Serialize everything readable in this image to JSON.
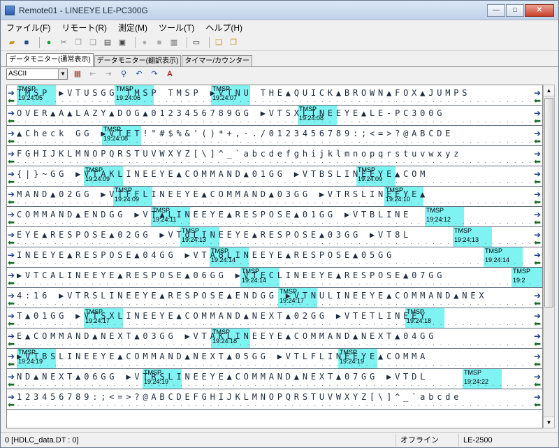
{
  "window": {
    "title": "Remote01 - LINEEYE LE-PC300G"
  },
  "window_controls": {
    "minimize": "—",
    "maximize": "□",
    "close": "✕"
  },
  "menu": [
    "ファイル(F)",
    "リモート(R)",
    "測定(M)",
    "ツール(T)",
    "ヘルプ(H)"
  ],
  "tabs": [
    "データモニター(通常表示)",
    "データモニター(翻訳表示)",
    "タイマー/カウンター"
  ],
  "code_select": {
    "value": "ASCII"
  },
  "rows": [
    {
      "text": "TMSP ▶VTUSGG TMSP TMSP ▶VTNU THE▲QUICK▲BROWN▲FOX▲JUMPS",
      "stamps": [
        {
          "label": "TMSP",
          "time": "19:24:05"
        },
        {
          "label": "TMSP",
          "time": "19:24:06"
        },
        {
          "label": "TMSP",
          "time": "19:24:07"
        }
      ]
    },
    {
      "text": "OVER▲A▲LAZY▲DOG▲0123456789GG ▶VTSXLINEEYE▲LE-PC300G",
      "stamps": [
        {
          "label": "TMSP",
          "time": "19:24:08"
        }
      ]
    },
    {
      "text": "▲Check GG ▶VTET!\"#$%&'()*+,-./0123456789:;<=>?@ABCDE",
      "stamps": [
        {
          "label": "TMSP",
          "time": "19:24:08"
        }
      ]
    },
    {
      "text": "FGHIJKLMNOPQRSTUVWXYZ[\\]^_`abcdefghijklmnopqrstuvwxyz",
      "stamps": []
    },
    {
      "text": "{|}~GG ▶VTAKLINEEYE▲COMMAND▲01GG ▶VTBSLINEEYE▲COM",
      "stamps": [
        {
          "label": "TMSP",
          "time": "19:24:09"
        },
        {
          "label": "TMSP",
          "time": "19:24:09"
        }
      ]
    },
    {
      "text": "MAND▲02GG ▶VTFFLINEEYE▲COMMAND▲03GG ▶VTRSLINEEYE▲",
      "stamps": [
        {
          "label": "TMSP",
          "time": "19:24:09"
        },
        {
          "label": "TMSP",
          "time": "19:24:10"
        }
      ]
    },
    {
      "text": "COMMAND▲ENDGG ▶VT▲LINEEYE▲RESPOSE▲01GG ▶VTBLINE",
      "stamps": [
        {
          "label": "TMSP",
          "time": "19:24:11"
        },
        {
          "label": "TMSP",
          "time": "19:24:12"
        }
      ]
    },
    {
      "text": "EYE▲RESPOSE▲02GG ▶VTdLINEEYE▲RESPOSE▲03GG ▶VT8L",
      "stamps": [
        {
          "label": "TMSP",
          "time": "19:24:13"
        },
        {
          "label": "TMSP",
          "time": "19:24:13"
        }
      ]
    },
    {
      "text": "INEEYE▲RESPOSE▲04GG ▶VTA8LINEEYE▲RESPOSE▲05GG",
      "stamps": [
        {
          "label": "TMSP",
          "time": "19:24:14"
        },
        {
          "label": "TMSP",
          "time": "19:24:14"
        }
      ]
    },
    {
      "text": "▶VTCALINEEYE▲RESPOSE▲06GG ▶VTECLINEEYE▲RESPOSE▲07GG",
      "stamps": [
        {
          "label": "TMSP",
          "time": "19:24:14"
        },
        {
          "label": "TMSP",
          "time": "19:2"
        }
      ]
    },
    {
      "text": "4:16 ▶VTRSLINEEYE▲RESPOSE▲ENDGG ▶VTNULINEEYE▲COMMAND▲NEX",
      "stamps": [
        {
          "label": "TMSP",
          "time": "19:24:17"
        }
      ]
    },
    {
      "text": "T▲01GG ▶VTSXLINEEYE▲COMMAND▲NEXT▲02GG ▶VTETLINEEY",
      "stamps": [
        {
          "label": "TMSP",
          "time": "19:24:17"
        },
        {
          "label": "TMSP",
          "time": "19:24:18"
        }
      ]
    },
    {
      "text": "E▲COMMAND▲NEXT▲03GG ▶VTAKLINEEYE▲COMMAND▲NEXT▲04GG",
      "stamps": [
        {
          "label": "TMSP",
          "time": "19:24:18"
        }
      ]
    },
    {
      "text": "▶VTBSLINEEYE▲COMMAND▲NEXT▲05GG ▶VTLFLINEEYE▲COMMA",
      "stamps": [
        {
          "label": "TMSP",
          "time": "19:24:19"
        },
        {
          "label": "TMSP",
          "time": "19:24:19"
        }
      ]
    },
    {
      "text": "ND▲NEXT▲06GG ▶VTRSLINEEYE▲COMMAND▲NEXT▲07GG ▶VTDL",
      "stamps": [
        {
          "label": "TMSP",
          "time": "19:24:19"
        },
        {
          "label": "TMSP",
          "time": "19:24:22"
        }
      ]
    },
    {
      "text": "123456789:;<=>?@ABCDEFGHIJKLMNOPQRSTUVWXYZ[\\]^_`abcde",
      "stamps": []
    }
  ],
  "status": {
    "file": "0 [HDLC_data.DT : 0]",
    "mode": "オフライン",
    "device": "LE-2500"
  }
}
